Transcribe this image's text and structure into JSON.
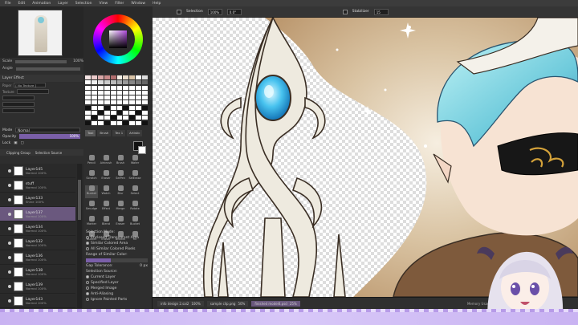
{
  "menu": [
    "File",
    "Edit",
    "Animation",
    "Layer",
    "Selection",
    "View",
    "Filter",
    "Window",
    "Help"
  ],
  "toolbar": {
    "selection_label": "Selection",
    "zoom": "100%",
    "angle": "0.0°",
    "stabilizer_label": "Stabilizer",
    "stabilizer_value": "15"
  },
  "navigator": {
    "scale_label": "Scale",
    "scale_value": "100%",
    "angle_label": "Angle"
  },
  "layer_effect": {
    "header": "Layer Effect",
    "paper_label": "Paper",
    "paper_value": "[ No Texture ]",
    "texture_label": "Texture"
  },
  "layer_panel": {
    "mode_label": "Mode",
    "mode_value": "Normal",
    "opacity_label": "Opacity",
    "opacity_value": "100%",
    "lock_label": "Lock",
    "clipping_group": "Clipping Group",
    "selection_source": "Selection Source",
    "layers": [
      {
        "name": "Layer145",
        "sub": "Normal 100%"
      },
      {
        "name": "stuff",
        "sub": "Normal 100%"
      },
      {
        "name": "Layer133",
        "sub": "Shine 100%"
      },
      {
        "name": "Layer137",
        "sub": "Normal 100%"
      },
      {
        "name": "Layer134",
        "sub": "Normal 100%"
      },
      {
        "name": "Layer132",
        "sub": "Normal 100%"
      },
      {
        "name": "Layer136",
        "sub": "Normal 100%"
      },
      {
        "name": "Layer138",
        "sub": "Normal 100%"
      },
      {
        "name": "Layer139",
        "sub": "Normal 100%"
      },
      {
        "name": "Layer143",
        "sub": "Normal 100%"
      }
    ]
  },
  "tool_tabs": [
    "Tool",
    "Brush",
    "Tex 1",
    "Artistic"
  ],
  "tools": [
    "Pencil",
    "Airbrush",
    "Brush",
    "Water",
    "Scratch",
    "Eraser",
    "SelPen",
    "SelErase",
    "Bucket",
    "Watch",
    "Blur",
    "Select",
    "Smudge",
    "Effect",
    "Merge",
    "Rotate",
    "Marker",
    "Blend",
    "Eraser",
    "Bucket",
    "Bucket",
    "Eraser",
    "Bucket",
    "Fill"
  ],
  "tool_props": {
    "selection_mode_label": "Selection Mode:",
    "mode_options": [
      "Enclosed Transparent Area",
      "Similar Colored Area",
      "All Similar Colored Pixels"
    ],
    "range_label": "Range of Similar Color:",
    "gap_label": "Gap Tolerance:",
    "gap_value": "0 px",
    "source_label": "Selection Source:",
    "source_options": [
      "Current Layer",
      "Specified Layer",
      "Merged Image"
    ],
    "anti_aliasing": "Anti-Aliasing",
    "ignore_painted": "Ignore Painted Parts"
  },
  "status": {
    "tabs": [
      {
        "name": "info design 2.sai2",
        "zoom": "100%"
      },
      {
        "name": "sample clip.png",
        "zoom": "50%"
      },
      {
        "name": "finished model4.psd",
        "zoom": "25%"
      }
    ],
    "memory_label": "Memory Usage"
  },
  "colors": {
    "accent": "#7a5fa8",
    "selected_layer": "#6a587e",
    "panel": "#2e2e2e"
  }
}
